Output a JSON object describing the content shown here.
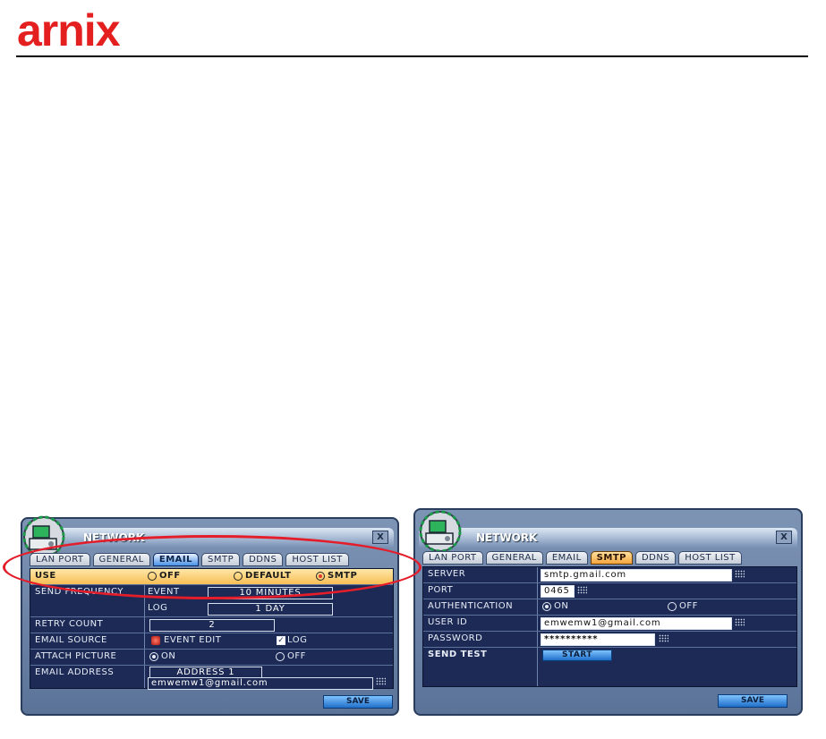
{
  "brand": {
    "logo_text": "arnix"
  },
  "left_dialog": {
    "title": "NETWORK",
    "close": "X",
    "tabs": [
      "LAN PORT",
      "GENERAL",
      "EMAIL",
      "SMTP",
      "DDNS",
      "HOST LIST"
    ],
    "active_tab": "EMAIL",
    "use": {
      "label": "USE",
      "options": [
        "OFF",
        "DEFAULT",
        "SMTP"
      ],
      "selected": "SMTP"
    },
    "send_frequency": {
      "label": "SEND FREQUENCY",
      "event_label": "EVENT",
      "event_value": "10 MINUTES",
      "log_label": "LOG",
      "log_value": "1 DAY"
    },
    "retry_count": {
      "label": "RETRY COUNT",
      "value": "2"
    },
    "email_source": {
      "label": "EMAIL SOURCE",
      "event_edit": "EVENT EDIT",
      "log": "LOG",
      "log_checked": true
    },
    "attach_picture": {
      "label": "ATTACH PICTURE",
      "on": "ON",
      "off": "OFF",
      "selected": "ON"
    },
    "email_address": {
      "label": "EMAIL ADDRESS",
      "address_select": "ADDRESS 1",
      "value": "emwemw1@gmail.com"
    },
    "save_label": "SAVE"
  },
  "right_dialog": {
    "title": "NETWORK",
    "close": "X",
    "tabs": [
      "LAN PORT",
      "GENERAL",
      "EMAIL",
      "SMTP",
      "DDNS",
      "HOST LIST"
    ],
    "active_tab": "SMTP",
    "server": {
      "label": "SERVER",
      "value": "smtp.gmail.com"
    },
    "port": {
      "label": "PORT",
      "value": "0465"
    },
    "authentication": {
      "label": "AUTHENTICATION",
      "on": "ON",
      "off": "OFF",
      "selected": "ON"
    },
    "user_id": {
      "label": "USER ID",
      "value": "emwemw1@gmail.com"
    },
    "password": {
      "label": "PASSWORD",
      "value": "**********"
    },
    "send_test": {
      "label": "SEND TEST",
      "button": "START"
    },
    "save_label": "SAVE"
  },
  "colors": {
    "brand_red": "#e3201f",
    "panel_bg": "#1c2a55",
    "highlight": "#f6bd55",
    "annotation": "#e41d2b"
  },
  "icons": [
    "network-camera-icon",
    "close-icon",
    "keyboard-icon",
    "radio-icon",
    "checkbox-icon",
    "event-edit-icon"
  ]
}
